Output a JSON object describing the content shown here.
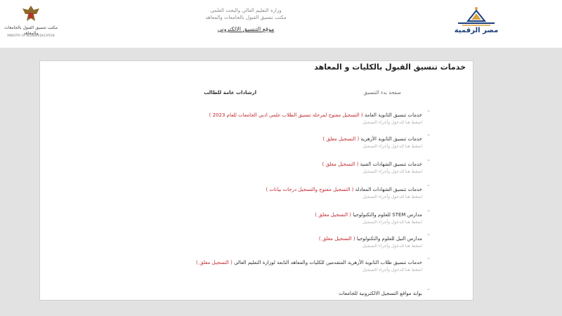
{
  "header": {
    "digital_logo_text": "مصر الرقمية",
    "center_line1": "وزارة التعليم العالي والبحث العلمي",
    "center_line2": "مكتب تنسيق القبول بالجامعات والمعاهد",
    "center_line3": "موقع التنسيق الالكتروني",
    "gov_logo_text": "مكتب تنسيق القبول بالجامعات والمعاهد",
    "gov_logo_sub": "MINISTRY OF HIGHER EDUCATION"
  },
  "page": {
    "title": "خدمات تنسيق القبول بالكليات و المعاهد",
    "main_label": "صفحة بدء التنسيق",
    "guide_label": "ارشادات عامة للطالب"
  },
  "menu": [
    {
      "title": "خدمات تنسيق الثانوية العامة",
      "status": "( التسجيل مفتوح لمرحلة تنسيق الطلاب علمي ادبي الجامعات للعام 2023 )",
      "sub": "اضغط هنا للدخول وأجراء التسجيل"
    },
    {
      "title": "خدمات تنسيق الثانوية الأزهرية",
      "status": "( التسجيل مغلق )",
      "sub": "اضغط هنا للدخول وأجراء التسجيل"
    },
    {
      "title": "خدمات تنسيق الشهادات الفنية",
      "status": "( التسجيل مغلق )",
      "sub": "اضغط هنا للدخول وأجراء التسجيل"
    },
    {
      "title": "خدمات تنسيق الشهادات المعادلة",
      "status": "( التسجيل مفتوح والتسجيل درجات بيانات )",
      "sub": "اضغط هنا للدخول وأجراء التسجيل"
    },
    {
      "title": "مدارس STEM للعلوم والتكنولوجيا",
      "status": "( التسجيل مغلق )",
      "sub": "اضغط هنا للدخول وأجراء التسجيل"
    },
    {
      "title": "مدارس النيل للعلوم والتكنولوجيا",
      "status": "( التسجيل مغلق )",
      "sub": "اضغط هنا للدخول وأجراء التسجيل"
    },
    {
      "title": "خدمات تنسيق طلاب الثانوية الأزهرية المتقدمين للكليات والمعاهد التابعة لوزارة التعليم العالي",
      "status": "( التسجيل مغلق )",
      "sub": "اضغط هنا للدخول وأجراء التسجيل"
    },
    {
      "title": "بوابة مواقع التسجيل الالكترونية للجامعات",
      "status": "",
      "sub": ""
    }
  ],
  "colors": {
    "accent_red": "#c0282e",
    "brand_blue": "#1b3f7c",
    "brand_gold": "#d9a441",
    "background": "#e2e2e2"
  }
}
